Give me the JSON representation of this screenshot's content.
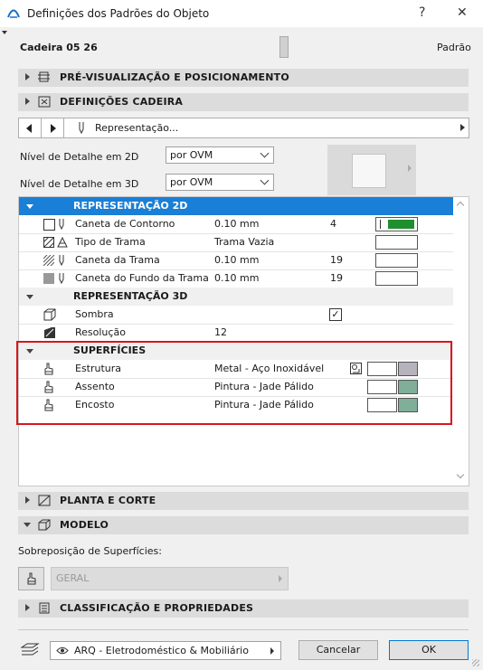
{
  "window": {
    "title": "Definições dos Padrões do Objeto",
    "help": "?",
    "close": "✕"
  },
  "header": {
    "object_name": "Cadeira 05 26",
    "mode": "Padrão"
  },
  "sections": {
    "preview": "PRÉ-VISUALIZAÇÃO E POSICIONAMENTO",
    "settings": "DEFINIÇÕES CADEIRA",
    "plan": "PLANTA E CORTE",
    "model": "MODELO",
    "classification": "CLASSIFICAÇÃO E PROPRIEDADES"
  },
  "nav": {
    "page": "Representação..."
  },
  "detail": {
    "label_2d": "Nível de Detalhe em 2D",
    "value_2d": "por OVM",
    "label_3d": "Nível de Detalhe em 3D",
    "value_3d": "por OVM"
  },
  "table": {
    "rep2d": {
      "title": "REPRESENTAÇÃO 2D",
      "rows": [
        {
          "name": "Caneta de Contorno",
          "value": "0.10 mm",
          "num": "4"
        },
        {
          "name": "Tipo de Trama",
          "value": "Trama Vazia",
          "num": ""
        },
        {
          "name": "Caneta da Trama",
          "value": "0.10 mm",
          "num": "19"
        },
        {
          "name": "Caneta do Fundo da Trama",
          "value": "0.10 mm",
          "num": "19"
        }
      ]
    },
    "rep3d": {
      "title": "REPRESENTAÇÃO 3D",
      "rows": [
        {
          "name": "Sombra",
          "value": "",
          "checked": "✓"
        },
        {
          "name": "Resolução",
          "value": "12"
        }
      ]
    },
    "surfaces": {
      "title": "SUPERFÍCIES",
      "rows": [
        {
          "name": "Estrutura",
          "value": "Metal - Aço Inoxidável",
          "color": "#b6b3bd"
        },
        {
          "name": "Assento",
          "value": "Pintura - Jade Pálido",
          "color": "#7fae99"
        },
        {
          "name": "Encosto",
          "value": "Pintura - Jade Pálido",
          "color": "#7fae99"
        }
      ]
    },
    "pen_color": "#1e8f2e",
    "selected_color": "#1a7fd6",
    "highlight_color": "#d9161b"
  },
  "model": {
    "overlay_label": "Sobreposição de Superfícies:",
    "overlay_value": "GERAL"
  },
  "footer": {
    "layer": "ARQ - Eletrodoméstico & Mobiliário",
    "cancel": "Cancelar",
    "ok": "OK"
  }
}
